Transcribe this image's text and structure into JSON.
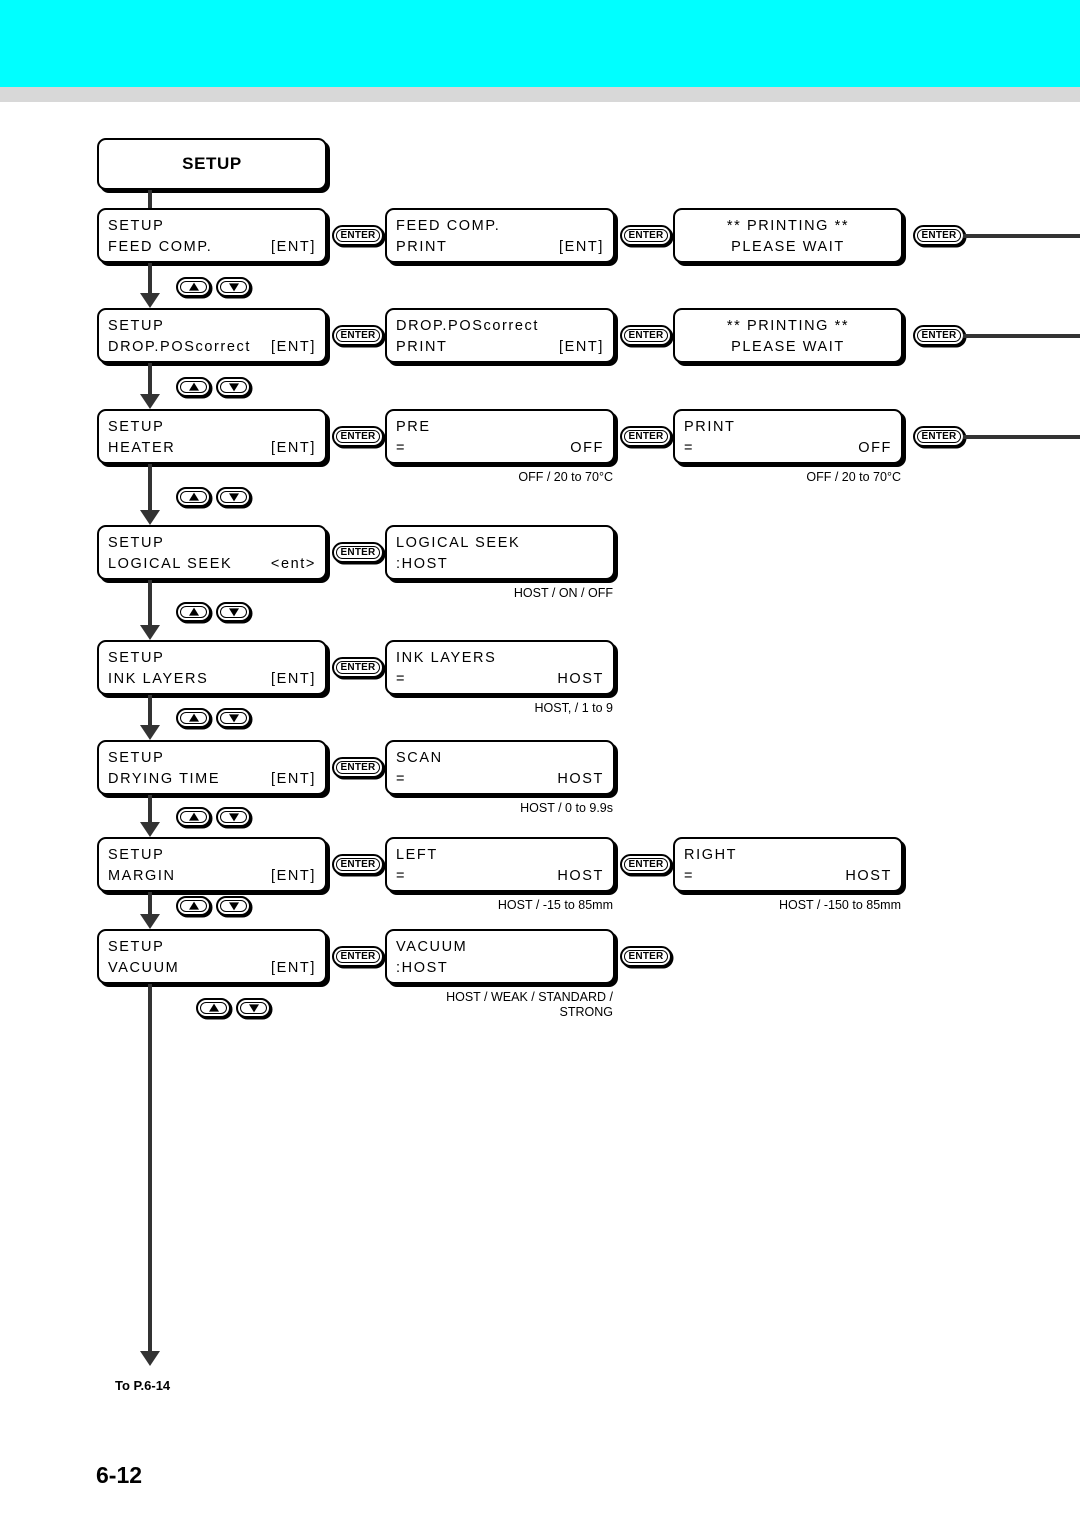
{
  "page": {
    "number": "6-12",
    "continue_label": "To P.6-14",
    "header_color": "#00ffff",
    "rule_color": "#d8d8d8"
  },
  "title_box": {
    "label": "SETUP"
  },
  "buttons": {
    "enter_label": "ENTER",
    "up_icon": "triangle-up-icon",
    "down_icon": "triangle-down-icon"
  },
  "rows": [
    {
      "menu": {
        "line1": "SETUP",
        "line2_left": "FEED COMP.",
        "line2_right": "[ENT]"
      },
      "sub1": {
        "line1": "FEED COMP.",
        "line2_left": "PRINT",
        "line2_right": "[ENT]"
      },
      "sub2": {
        "line1": "** PRINTING **",
        "line2_left": "PLEASE WAIT",
        "centered": true
      }
    },
    {
      "menu": {
        "line1": "SETUP",
        "line2_left": "DROP.POScorrect",
        "line2_right": "[ENT]"
      },
      "sub1": {
        "line1": "DROP.POScorrect",
        "line2_left": "PRINT",
        "line2_right": "[ENT]"
      },
      "sub2": {
        "line1": "** PRINTING **",
        "line2_left": "PLEASE WAIT",
        "centered": true
      }
    },
    {
      "menu": {
        "line1": "SETUP",
        "line2_left": "HEATER",
        "line2_right": "[ENT]"
      },
      "sub1": {
        "line1": "PRE",
        "line2_left": "=",
        "line2_right": "OFF",
        "caption": "OFF / 20 to 70°C"
      },
      "sub2": {
        "line1": "PRINT",
        "line2_left": "=",
        "line2_right": "OFF",
        "caption": "OFF / 20 to 70°C"
      }
    },
    {
      "menu": {
        "line1": "SETUP",
        "line2_left": "LOGICAL SEEK",
        "line2_right": "<ent>"
      },
      "sub1": {
        "line1": "LOGICAL SEEK",
        "line2_left": ":HOST",
        "line2_right": "",
        "caption": "HOST / ON / OFF"
      }
    },
    {
      "menu": {
        "line1": "SETUP",
        "line2_left": "INK LAYERS",
        "line2_right": "[ENT]"
      },
      "sub1": {
        "line1": "INK LAYERS",
        "line2_left": "=",
        "line2_right": "HOST",
        "caption": "HOST, / 1 to 9"
      }
    },
    {
      "menu": {
        "line1": "SETUP",
        "line2_left": "DRYING TIME",
        "line2_right": "[ENT]"
      },
      "sub1": {
        "line1": "SCAN",
        "line2_left": "=",
        "line2_right": "HOST",
        "caption": "HOST / 0 to 9.9s"
      }
    },
    {
      "menu": {
        "line1": "SETUP",
        "line2_left": "MARGIN",
        "line2_right": "[ENT]"
      },
      "sub1": {
        "line1": "LEFT",
        "line2_left": "=",
        "line2_right": "HOST",
        "caption": "HOST / -15 to 85mm"
      },
      "sub2": {
        "line1": "RIGHT",
        "line2_left": "=",
        "line2_right": "HOST",
        "caption": "HOST / -150 to 85mm"
      }
    },
    {
      "menu": {
        "line1": "SETUP",
        "line2_left": "VACUUM",
        "line2_right": "[ENT]"
      },
      "sub1": {
        "line1": "VACUUM",
        "line2_left": ":HOST",
        "line2_right": "",
        "caption": "HOST / WEAK / STANDARD /\nSTRONG"
      }
    }
  ]
}
